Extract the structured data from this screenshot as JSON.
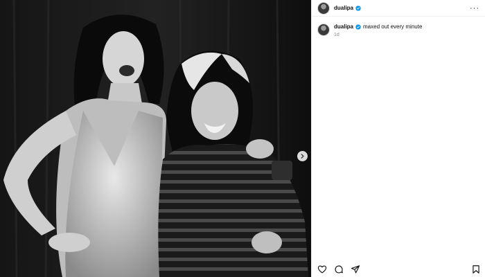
{
  "post": {
    "username": "dualipa",
    "verified": true,
    "caption": "maxed out every minute",
    "time": "1d"
  },
  "header": {
    "more_label": "···"
  },
  "icons": {
    "verified": "verified-badge-icon",
    "next": "chevron-right-icon",
    "like": "heart-icon",
    "comment": "comment-icon",
    "share": "send-icon",
    "save": "bookmark-icon"
  },
  "colors": {
    "verified": "#0095f6",
    "photo_bg": "#0c0c0c"
  }
}
